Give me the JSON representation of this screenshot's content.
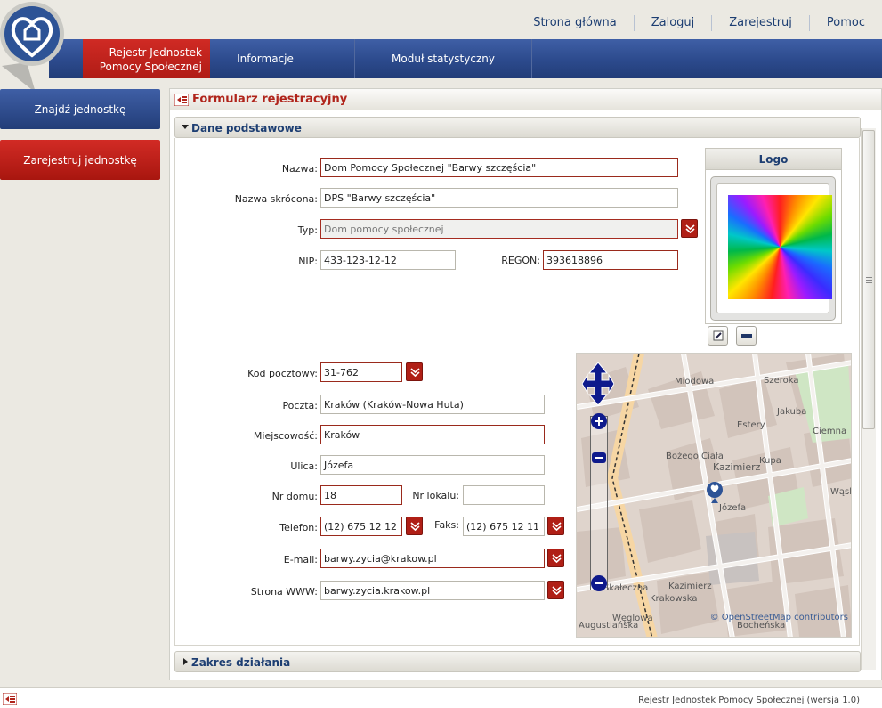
{
  "top_links": [
    "Strona główna",
    "Zaloguj",
    "Zarejestruj",
    "Pomoc"
  ],
  "app_title_line1": "Rejestr Jednostek",
  "app_title_line2": "Pomocy Społecznej",
  "nav": {
    "informacje": "Informacje",
    "modul": "Moduł statystyczny"
  },
  "left": {
    "find": "Znajdź jednostkę",
    "register": "Zarejestruj jednostkę"
  },
  "form_title": "Formularz rejestracyjny",
  "section_basic": "Dane podstawowe",
  "section_scope": "Zakres działania",
  "logo_title": "Logo",
  "fields": {
    "nazwa": {
      "label": "Nazwa:",
      "value": "Dom Pomocy Społecznej \"Barwy szczęścia\""
    },
    "skrot": {
      "label": "Nazwa skrócona:",
      "value": "DPS \"Barwy szczęścia\""
    },
    "typ": {
      "label": "Typ:",
      "value": "Dom pomocy społecznej"
    },
    "nip": {
      "label": "NIP:",
      "value": "433-123-12-12"
    },
    "regon": {
      "label": "REGON:",
      "value": "393618896"
    },
    "kod": {
      "label": "Kod pocztowy:",
      "value": "31-762"
    },
    "poczta": {
      "label": "Poczta:",
      "value": "Kraków (Kraków-Nowa Huta)"
    },
    "miejsc": {
      "label": "Miejscowość:",
      "value": "Kraków"
    },
    "ulica": {
      "label": "Ulica:",
      "value": "Józefa"
    },
    "nrdomu": {
      "label": "Nr domu:",
      "value": "18"
    },
    "nrlokalu": {
      "label": "Nr lokalu:",
      "value": ""
    },
    "telefon": {
      "label": "Telefon:",
      "value": "(12) 675 12 12"
    },
    "faks": {
      "label": "Faks:",
      "value": "(12) 675 12 11"
    },
    "email": {
      "label": "E-mail:",
      "value": "barwy.zycia@krakow.pl"
    },
    "www": {
      "label": "Strona WWW:",
      "value": "barwy.zycia.krakow.pl"
    }
  },
  "map": {
    "attribution": "© OpenStreetMap contributors",
    "labels": [
      "Kazimierz",
      "Józefa",
      "Miodowa",
      "Bożego Ciała",
      "Estery",
      "Kupa",
      "Jakuba",
      "Ciemna",
      "Szeroka",
      "Skałeczna",
      "Węglowa",
      "Augustiańska",
      "Bocheńska",
      "Krakowska",
      "Wąska",
      "Kazimierz"
    ]
  },
  "footer": "Rejestr Jednostek Pomocy Społecznej (wersja 1.0)",
  "colors": {
    "brand_red": "#b01f16",
    "nav_blue": "#2c4a8c"
  }
}
